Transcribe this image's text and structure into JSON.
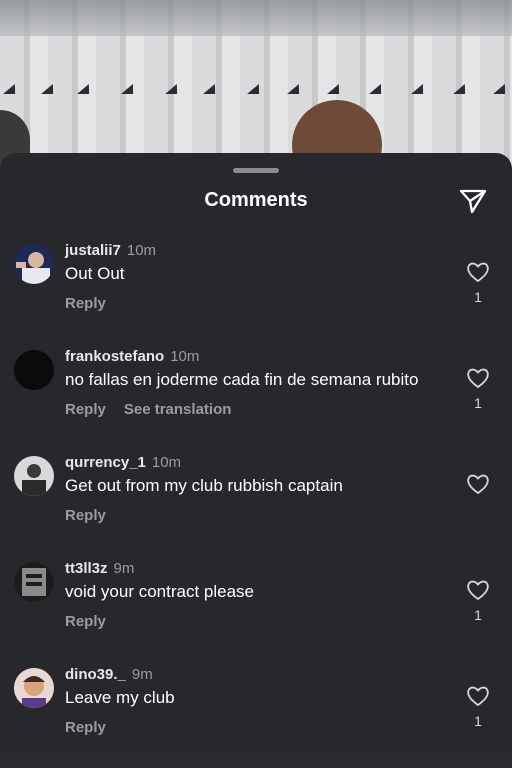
{
  "header": {
    "title": "Comments"
  },
  "comments": [
    {
      "username": "justalii7",
      "time": "10m",
      "text": "Out Out",
      "reply_label": "Reply",
      "translate_label": "",
      "likes": "1",
      "avatar": "#1b2a56"
    },
    {
      "username": "frankostefano",
      "time": "10m",
      "text": "no fallas en joderme cada fin de semana rubito",
      "reply_label": "Reply",
      "translate_label": "See translation",
      "likes": "1",
      "avatar": "#0b0b0c"
    },
    {
      "username": "qurrency_1",
      "time": "10m",
      "text": "Get out from my club rubbish captain",
      "reply_label": "Reply",
      "translate_label": "",
      "likes": "",
      "avatar": "#4a4a4c"
    },
    {
      "username": "tt3ll3z",
      "time": "9m",
      "text": "void your contract please",
      "reply_label": "Reply",
      "translate_label": "",
      "likes": "1",
      "avatar": "#5a5a5a"
    },
    {
      "username": "dino39._",
      "time": "9m",
      "text": "Leave my club",
      "reply_label": "Reply",
      "translate_label": "",
      "likes": "1",
      "avatar": "#c98a5a"
    }
  ]
}
